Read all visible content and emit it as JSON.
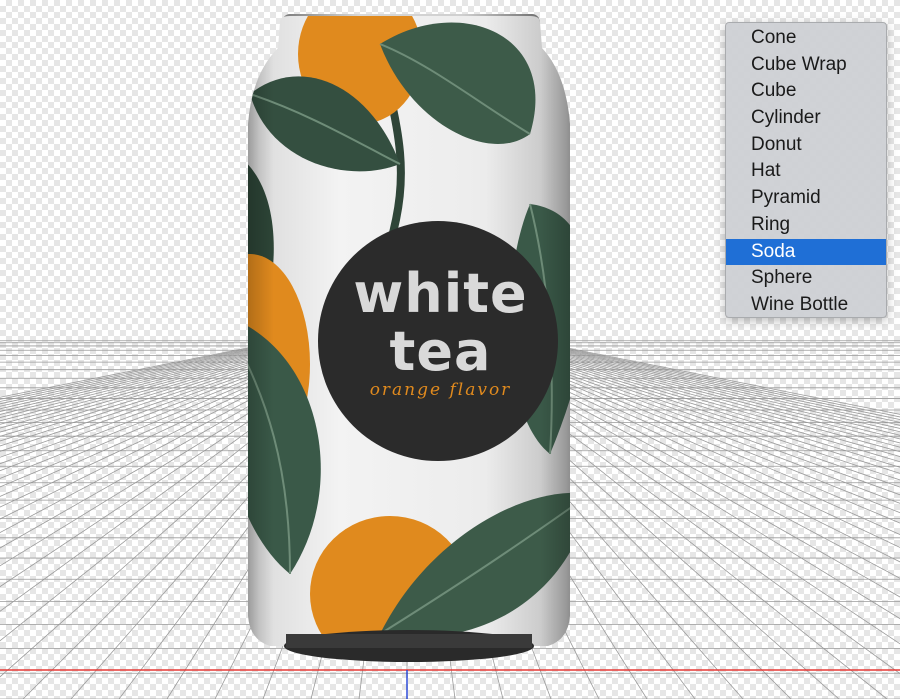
{
  "can": {
    "title_line1": "white",
    "title_line2": "tea",
    "subtitle": "orange flavor",
    "colors": {
      "label_circle": "#2b2b2b",
      "leaf": "#3c5a48",
      "orange": "#e08a1e",
      "can_body": "#ededed"
    }
  },
  "shape_menu": {
    "items": [
      {
        "label": "Cone"
      },
      {
        "label": "Cube Wrap"
      },
      {
        "label": "Cube"
      },
      {
        "label": "Cylinder"
      },
      {
        "label": "Donut"
      },
      {
        "label": "Hat"
      },
      {
        "label": "Pyramid"
      },
      {
        "label": "Ring"
      },
      {
        "label": "Soda",
        "selected": true
      },
      {
        "label": "Sphere"
      },
      {
        "label": "Wine Bottle"
      }
    ],
    "selected_color": "#1f6fd6"
  },
  "ground": {
    "horizon_color": "#e53935",
    "axis_color": "#1e3fd6"
  }
}
